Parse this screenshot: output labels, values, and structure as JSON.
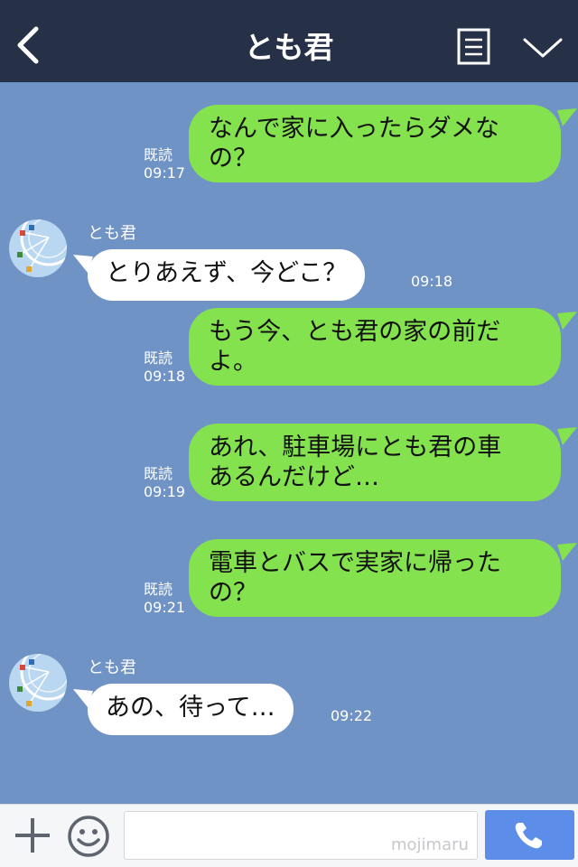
{
  "header": {
    "title": "とも君",
    "back_icon": "chevron-left-icon",
    "menu_icon": "list-menu-icon",
    "collapse_icon": "chevron-down-icon"
  },
  "colors": {
    "header_bg": "#263147",
    "chat_bg": "#7093c5",
    "sent_bubble": "#84e24e",
    "received_bubble": "#ffffff",
    "call_button": "#5c8de8"
  },
  "messages": [
    {
      "direction": "sent",
      "lines": [
        "なんで家に入ったらダメな",
        "の？"
      ],
      "read": "既読",
      "time": "09:17"
    },
    {
      "direction": "received",
      "sender": "とも君",
      "text": "とりあえず、今どこ？",
      "time": "09:18"
    },
    {
      "direction": "sent",
      "lines": [
        "もう今、とも君の家の前だ",
        "よ。"
      ],
      "read": "既読",
      "time": "09:18"
    },
    {
      "direction": "sent",
      "lines": [
        "あれ、駐車場にとも君の車",
        "あるんだけど…"
      ],
      "read": "既読",
      "time": "09:19"
    },
    {
      "direction": "sent",
      "lines": [
        "電車とバスで実家に帰った",
        "の？"
      ],
      "read": "既読",
      "time": "09:21"
    },
    {
      "direction": "received",
      "sender": "とも君",
      "text": "あの、待って…",
      "time": "09:22"
    }
  ],
  "footer": {
    "plus_icon": "plus-icon",
    "emoji_icon": "smiley-icon",
    "input_value": "",
    "watermark": "mojimaru",
    "call_icon": "phone-icon"
  }
}
